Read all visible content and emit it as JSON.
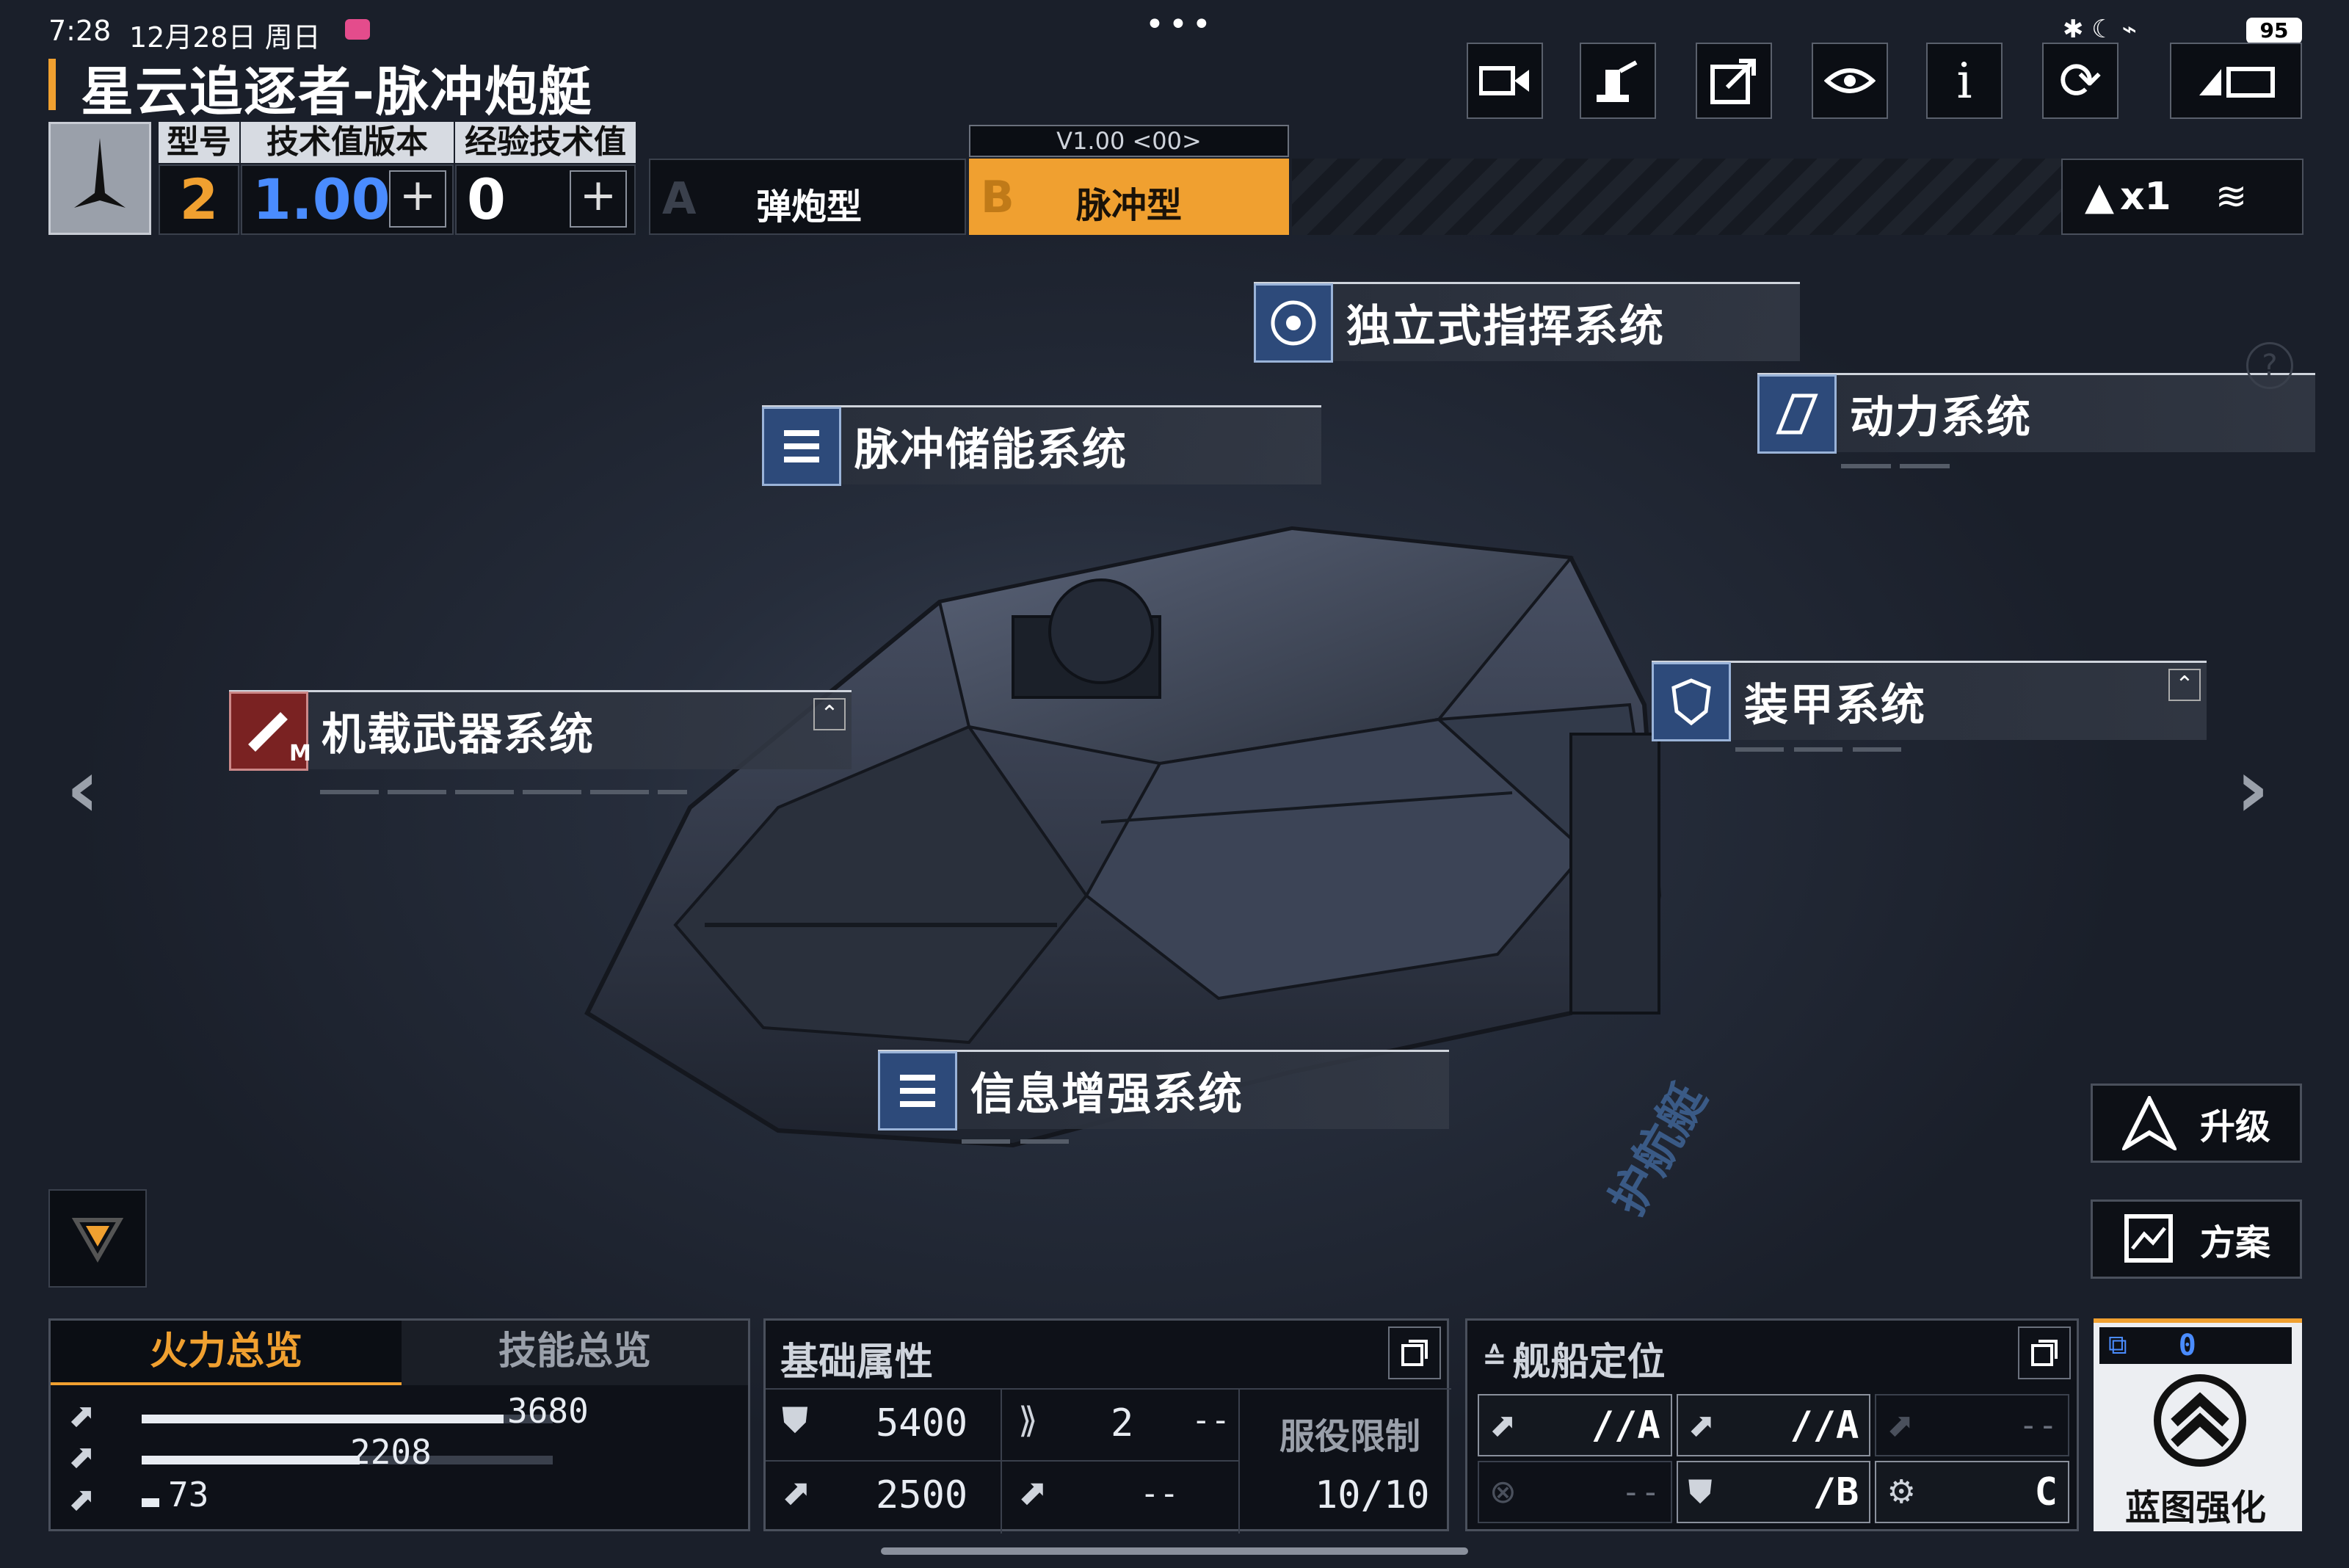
{
  "status_bar": {
    "time": "7:28",
    "date": "12月28日 周日",
    "more": "•••",
    "battery": "95"
  },
  "ship": {
    "name": "星云追逐者-脉冲炮艇"
  },
  "info_header": {
    "labels": [
      "型号",
      "技术值版本",
      "经验技术值"
    ],
    "model_value": "2",
    "tech_version": "1.00",
    "exp_value": "0",
    "plus": "+"
  },
  "variants": {
    "version_tag": "V1.00 <00>",
    "a_letter": "A",
    "a_label": "弹炮型",
    "b_letter": "B",
    "b_label": "脉冲型"
  },
  "fleet_counter": {
    "count": "x1"
  },
  "top_buttons": [
    "video-icon",
    "robot-arm-icon",
    "share-icon",
    "view-icon",
    "info-icon",
    "refresh-icon",
    "back-icon"
  ],
  "systems": [
    {
      "key": "command",
      "label": "独立式指挥系统"
    },
    {
      "key": "power",
      "label": "动力系统"
    },
    {
      "key": "pulse_storage",
      "label": "脉冲储能系统"
    },
    {
      "key": "weapons",
      "label": "机载武器系统",
      "badge": "M"
    },
    {
      "key": "armor",
      "label": "装甲系统"
    },
    {
      "key": "info_boost",
      "label": "信息增强系统"
    }
  ],
  "hull_marking": "护航艇",
  "right_actions": {
    "upgrade": "升级",
    "plan": "方案"
  },
  "firepower_panel": {
    "tabs": [
      "火力总览",
      "技能总览"
    ],
    "rows": [
      {
        "value": "3680",
        "ratio": 0.88
      },
      {
        "value": "2208",
        "ratio": 0.53
      },
      {
        "value": "73",
        "ratio": 0.02
      }
    ]
  },
  "attributes_panel": {
    "title": "基础属性",
    "hp": "5400",
    "armor_count": "2",
    "armor_extra": "--",
    "shield": "2500",
    "speed": "--",
    "service_label": "服役限制",
    "service_value": "10/10"
  },
  "positioning_panel": {
    "title": "舰船定位",
    "cells": [
      {
        "text": "//A"
      },
      {
        "text": "//A"
      },
      {
        "text": "--"
      },
      {
        "text": "--"
      },
      {
        "text": "/B"
      },
      {
        "text": "C"
      }
    ]
  },
  "blueprint": {
    "count": "0",
    "label": "蓝图强化"
  },
  "colors": {
    "accent_orange": "#f0a030",
    "panel_bg": "#0e1118",
    "icon_blue": "#2d4a7a",
    "weapon_red": "#7a2222"
  }
}
